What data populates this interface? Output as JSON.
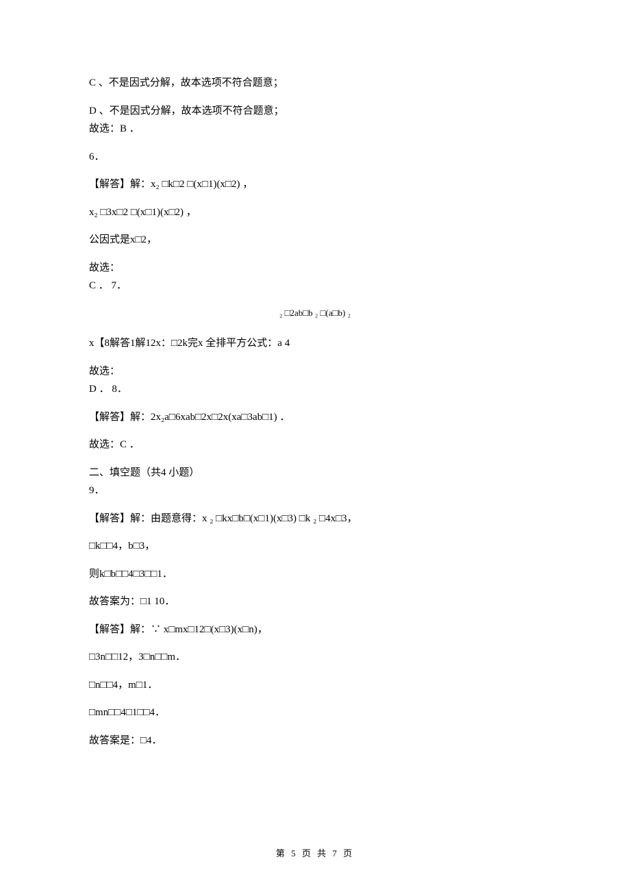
{
  "lines": {
    "c_option": "C 、不是因式分解，故本选项不符合题意；",
    "d_option": "D 、不是因式分解，故本选项不符合题意；",
    "d_answer": "故选：B ．",
    "q6": "6．",
    "q6_solve1": "【解答】解：x₂ □k□2 □(x□1)(x□2) ，",
    "q6_solve2": "x₂ □3x□2 □(x□1)(x□2) ，",
    "q6_solve3": "公因式是x□2，",
    "q6_answer1": "故选：",
    "q6_answer2": "C ．  7．",
    "q7_exp": "₂ □2ab□b  ₂ □(a□b)   ₂",
    "q7_solve": "x【8解答1解12x：□2k完x 全排平方公式：a 4",
    "q7_answer1": "故选：",
    "q7_answer2": "D ．  8．",
    "q8_solve": "【解答】解：2x₂a□6xab□2x□2x(xa□3ab□1) ．",
    "q8_answer": "故选：C ．",
    "section2_header": "二、填空题（共4 小题）",
    "q9": "9．",
    "q9_solve1": "【解答】解：由题意得：x ₂ □kx□b□(x□1)(x□3) □k     ₂ □4x□3，",
    "q9_solve2": "□k□□4，b□3，",
    "q9_solve3": "则k□b□□4□3□□1．",
    "q9_answer": "故答案为：□1 10．",
    "q10_solve1": "【解答】解：∵ x□mx□12□(x□3)(x□n)，",
    "q10_solve2": "□3n□□12，3□n□□m．",
    "q10_solve3": "□n□□4，m□1．",
    "q10_solve4": "□mn□□4□1□□4．",
    "q10_answer": "故答案是：□4．"
  },
  "footer": "第  5   页  共  7   页"
}
